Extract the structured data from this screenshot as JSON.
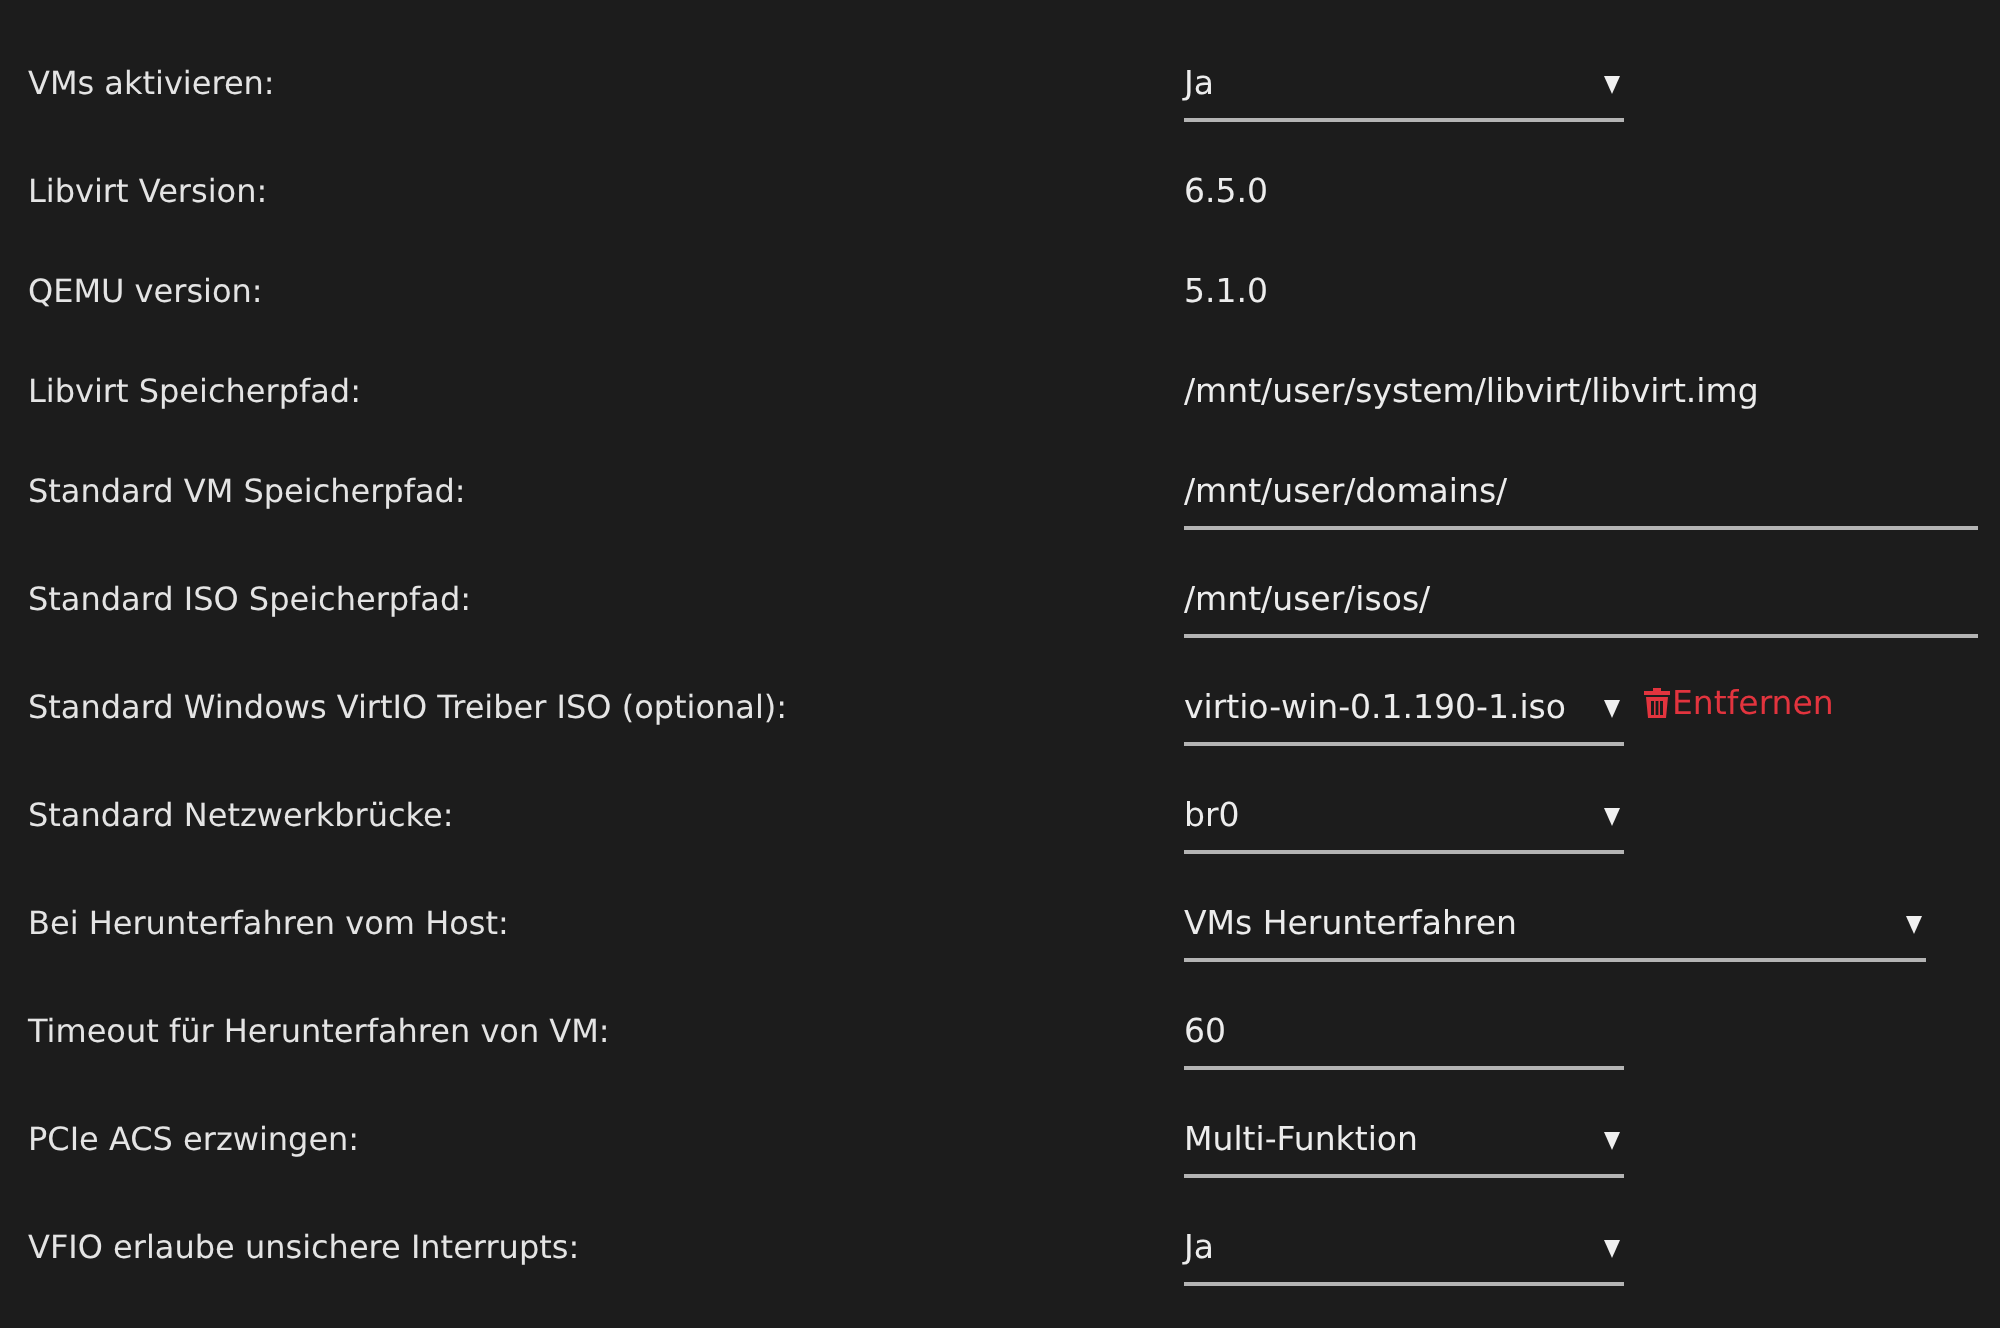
{
  "settings": [
    {
      "label": "VMs aktivieren:",
      "kind": "select",
      "value": "Ja"
    },
    {
      "label": "Libvirt Version:",
      "kind": "text",
      "value": "6.5.0"
    },
    {
      "label": "QEMU version:",
      "kind": "text",
      "value": "5.1.0"
    },
    {
      "label": "Libvirt Speicherpfad:",
      "kind": "text",
      "value": "/mnt/user/system/libvirt/libvirt.img"
    },
    {
      "label": "Standard VM Speicherpfad:",
      "kind": "input",
      "value": "/mnt/user/domains/"
    },
    {
      "label": "Standard ISO Speicherpfad:",
      "kind": "input",
      "value": "/mnt/user/isos/"
    },
    {
      "label": "Standard Windows VirtIO Treiber ISO (optional):",
      "kind": "select",
      "value": "virtio-win-0.1.190-1.iso",
      "action": {
        "label": "Entfernen"
      }
    },
    {
      "label": "Standard Netzwerkbrücke:",
      "kind": "select",
      "value": "br0"
    },
    {
      "label": "Bei Herunterfahren vom Host:",
      "kind": "select",
      "value": "VMs Herunterfahren"
    },
    {
      "label": "Timeout für Herunterfahren von VM:",
      "kind": "input",
      "value": "60"
    },
    {
      "label": "PCIe ACS erzwingen:",
      "kind": "select",
      "value": "Multi-Funktion"
    },
    {
      "label": "VFIO erlaube unsichere Interrupts:",
      "kind": "select",
      "value": "Ja"
    }
  ]
}
